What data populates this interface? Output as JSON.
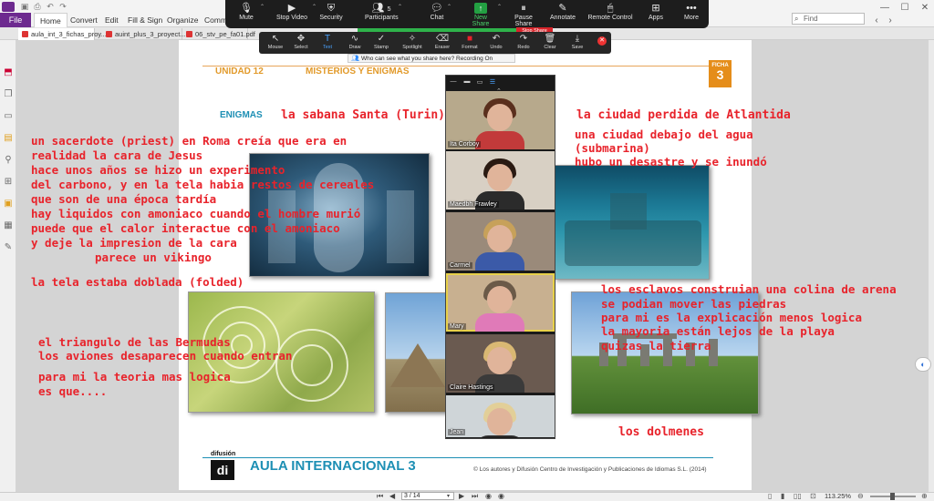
{
  "app": {
    "file_tab": "File",
    "menu": [
      "Home",
      "Convert",
      "Edit",
      "Fill & Sign",
      "Organize",
      "Comme"
    ],
    "search_placeholder": "Find",
    "doc_tabs": [
      "aula_int_3_fichas_proy...",
      "auint_plus_3_proyect...",
      "06_stv_pe_fa01.pdf"
    ]
  },
  "zoom_bar": {
    "buttons": [
      "Mute",
      "Stop Video",
      "Security",
      "Participants",
      "Chat",
      "New Share",
      "Pause Share",
      "Annotate",
      "Remote Control",
      "Apps",
      "More"
    ],
    "participants_count": "5",
    "sharing_banner": "You are screen sharing",
    "stop_share": "Stop Share"
  },
  "annotation_bar": {
    "tools": [
      "Mouse",
      "Select",
      "Text",
      "Draw",
      "Stamp",
      "Spotlight",
      "Eraser",
      "Format",
      "Undo",
      "Redo",
      "Clear",
      "Save"
    ],
    "selected": "Text",
    "who_can_see": "Who can see what you share here? Recording On"
  },
  "gallery": {
    "participants": [
      {
        "name": "Ita Corboy",
        "hair": "#5a2f1d",
        "top": "#c23a3a",
        "bg": "#b7a98c"
      },
      {
        "name": "Maedbh Frawley",
        "hair": "#2a1a12",
        "top": "#2b2b2b",
        "bg": "#d8d0c4"
      },
      {
        "name": "Carmel",
        "hair": "#c7a15a",
        "top": "#3b5aa8",
        "bg": "#9a8a7a"
      },
      {
        "name": "Mary",
        "hair": "#6b5a48",
        "top": "#e07ab8",
        "bg": "#c8b090"
      },
      {
        "name": "Claire Hastings",
        "hair": "#d9b873",
        "top": "#3a3a3a",
        "bg": "#6a5a50"
      },
      {
        "name": "Jean",
        "hair": "#e2cf98",
        "top": "#2c2c2c",
        "bg": "#cfd5d8"
      }
    ]
  },
  "page": {
    "unidad": "UNIDAD 12",
    "title": "MISTERIOS Y ENIGMAS",
    "ficha_label": "FICHA",
    "ficha_num": "3",
    "section": "ENIGMAS",
    "logo_text": "difusión",
    "logo_letter": "di",
    "footer_title": "AULA INTERNACIONAL 3",
    "copyright": "© Los autores y Difusión Centro de Investigación y Publicaciones de Idiomas S.L. (2014)"
  },
  "annotations": {
    "shroud_title": "la sabana Santa (Turin)",
    "shroud_lines": [
      "un sacerdote (priest) en Roma creía que era en",
      "realidad la cara de Jesus",
      "hace unos años se hizo un experimento",
      "del carbono, y en la tela habia restos de cereales",
      "que son de una época tardía",
      "hay liquidos con amoniaco cuando el hombre murió",
      "puede que el calor interactue con el amoniaco",
      "y deje la impresion de la cara"
    ],
    "viking": "parece un vikingo",
    "folded": "la tela estaba doblada (folded)",
    "atlantis_title": "la ciudad perdida de Atlantida",
    "atlantis_lines": [
      "una ciudad debajo del agua",
      "(submarina)",
      "hubo un desastre y se inundó"
    ],
    "bermuda_lines": [
      "el triangulo de las Bermudas",
      "los aviones desaparecen cuando entran"
    ],
    "logic_lines": [
      "para mi la teoria mas logica",
      "es que...."
    ],
    "stonehenge_lines": [
      "los esclavos construian una colina de arena",
      "se podian mover las piedras",
      "para mi es la explicación menos logica",
      "la mayoria están lejos de la playa",
      "quizas la tierra"
    ],
    "dolmenes": "los dolmenes"
  },
  "status": {
    "page_input": "3 / 14",
    "zoom": "113.25%"
  }
}
